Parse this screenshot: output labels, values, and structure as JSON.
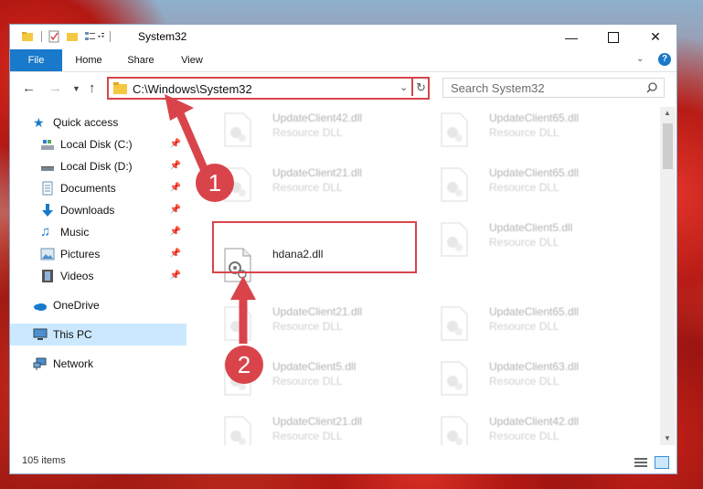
{
  "window": {
    "title": "System32"
  },
  "ribbon": {
    "tabs": [
      "File",
      "Home",
      "Share",
      "View"
    ]
  },
  "navbar": {
    "address": "C:\\Windows\\System32",
    "search_placeholder": "Search System32"
  },
  "sidebar": {
    "items": [
      {
        "label": "Quick access",
        "icon": "star-icon",
        "pinned": false
      },
      {
        "label": "Local Disk (C:)",
        "icon": "drive-icon",
        "pinned": true
      },
      {
        "label": "Local Disk (D:)",
        "icon": "drive-icon",
        "pinned": true
      },
      {
        "label": "Documents",
        "icon": "documents-icon",
        "pinned": true
      },
      {
        "label": "Downloads",
        "icon": "download-icon",
        "pinned": true
      },
      {
        "label": "Music",
        "icon": "music-icon",
        "pinned": true
      },
      {
        "label": "Pictures",
        "icon": "pictures-icon",
        "pinned": true
      },
      {
        "label": "Videos",
        "icon": "videos-icon",
        "pinned": true
      },
      {
        "label": "OneDrive",
        "icon": "cloud-icon",
        "pinned": false
      },
      {
        "label": "This PC",
        "icon": "computer-icon",
        "pinned": false
      },
      {
        "label": "Network",
        "icon": "network-icon",
        "pinned": false
      }
    ]
  },
  "files": {
    "col1": [
      {
        "name": "UpdateClient42.dll",
        "type": "Resource DLL"
      },
      {
        "name": "UpdateClient21.dll",
        "type": "Resource DLL"
      },
      {
        "name": "hdana2.dll",
        "type": ""
      },
      {
        "name": "UpdateClient21.dll",
        "type": "Resource DLL"
      },
      {
        "name": "UpdateClient5.dll",
        "type": "Resource DLL"
      },
      {
        "name": "UpdateClient21.dll",
        "type": "Resource DLL"
      }
    ],
    "col2": [
      {
        "name": "UpdateClient65.dll",
        "type": "Resource DLL"
      },
      {
        "name": "UpdateClient65.dll",
        "type": "Resource DLL"
      },
      {
        "name": "UpdateClient5.dll",
        "type": "Resource DLL"
      },
      {
        "name": "UpdateClient65.dll",
        "type": "Resource DLL"
      },
      {
        "name": "UpdateClient63.dll",
        "type": "Resource DLL"
      },
      {
        "name": "UpdateClient42.dll",
        "type": "Resource DLL"
      }
    ]
  },
  "status": {
    "item_count": "105 items"
  },
  "callouts": {
    "step1": "1",
    "step2": "2"
  },
  "colors": {
    "accent": "#1979ca",
    "highlight": "#d9444b"
  }
}
